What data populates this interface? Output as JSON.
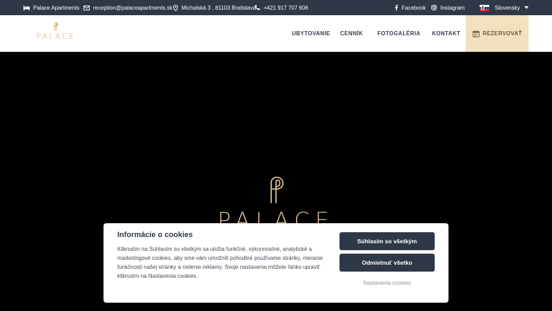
{
  "topbar": {
    "brand": "Palace Apartments",
    "email": "reception@palaceapartments.sk",
    "address": "Michalská 3 , 81103 Bratislava",
    "phone": "+421 917 707 606",
    "facebook": "Facebook",
    "instagram": "Instagram",
    "language": "Slovensky"
  },
  "navbar": {
    "logo_text": "PALACE",
    "links": [
      "UBYTOVANIE",
      "CENNÍK",
      "FOTOGALÉRIA",
      "KONTAKT"
    ],
    "reserve": "REZERVOVAŤ"
  },
  "hero": {
    "logo_text": "PALACE"
  },
  "cookie": {
    "title": "Informácie o cookies",
    "text": "Kliknutím na Súhlasím so všetkým sa uložia funkčné, výkonnostné, analytické a marketingové cookies, aby sme vám umožnili pohodlné používanie stránky, meranie funkčnosti našej stránky a cielenie reklamy. Svoje nastavenia môžete ľahko upraviť kliknutím na Nastavenia cookies.",
    "accept": "Súhlasím so všetkým",
    "reject": "Odmietnuť všetko",
    "settings": "Nastavenia cookies"
  },
  "colors": {
    "topbar": "#2f3846",
    "gold": "#c9a96a",
    "reserve_bg": "#f2e0bf",
    "button": "#2f3846"
  },
  "icons": [
    "bed-icon",
    "envelope-icon",
    "map-pin-icon",
    "phone-icon",
    "facebook-icon",
    "instagram-icon",
    "calendar-icon",
    "slovak-flag-icon"
  ]
}
